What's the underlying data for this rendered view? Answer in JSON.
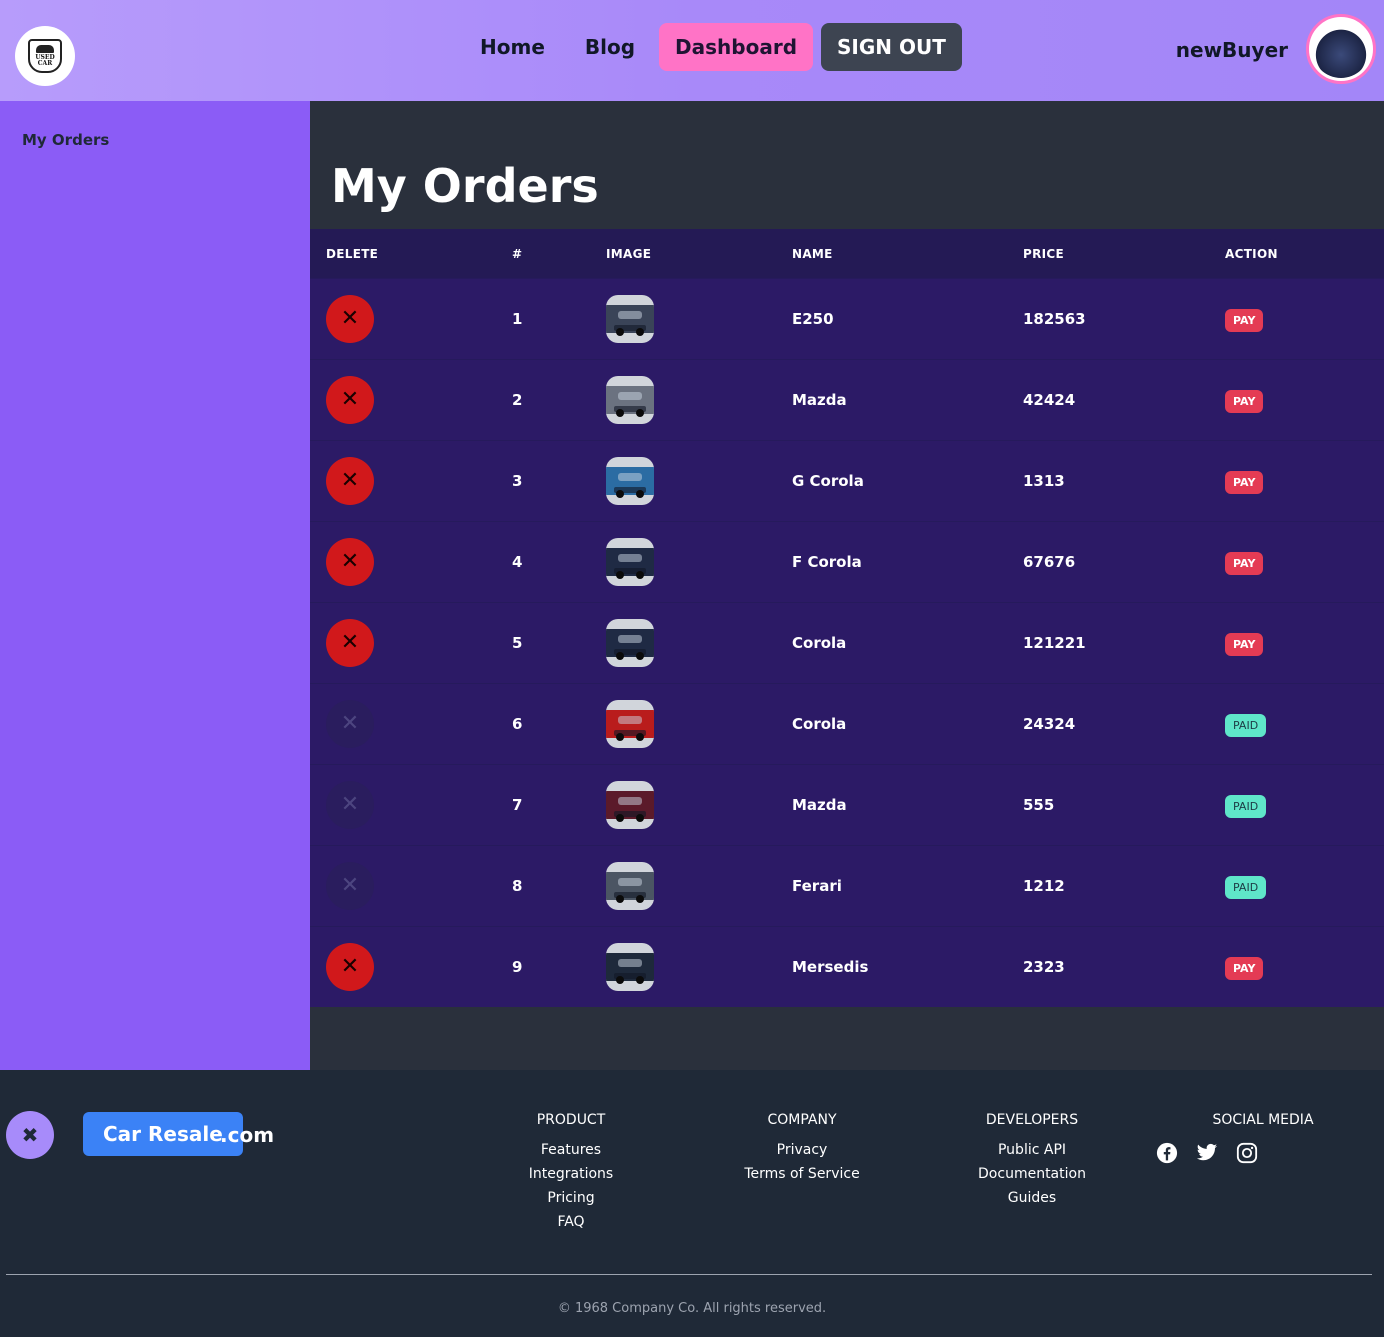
{
  "header": {
    "logo_text": "USED CAR",
    "nav": {
      "home": "Home",
      "blog": "Blog",
      "dashboard": "Dashboard",
      "signout": "SIGN OUT"
    },
    "username": "newBuyer"
  },
  "sidebar": {
    "items": [
      {
        "label": "My Orders"
      }
    ]
  },
  "main": {
    "title": "My Orders",
    "columns": [
      "DELETE",
      "#",
      "IMAGE",
      "NAME",
      "PRICE",
      "ACTION"
    ],
    "rows": [
      {
        "index": "1",
        "name": "E250",
        "price": "182563",
        "action": "PAY",
        "deletable": true,
        "thumb": "#3a4458"
      },
      {
        "index": "2",
        "name": "Mazda",
        "price": "42424",
        "action": "PAY",
        "deletable": true,
        "thumb": "#6b7280"
      },
      {
        "index": "3",
        "name": "G Corola",
        "price": "1313",
        "action": "PAY",
        "deletable": true,
        "thumb": "#2b6ca3"
      },
      {
        "index": "4",
        "name": "F Corola",
        "price": "67676",
        "action": "PAY",
        "deletable": true,
        "thumb": "#1f2a44"
      },
      {
        "index": "5",
        "name": "Corola",
        "price": "121221",
        "action": "PAY",
        "deletable": true,
        "thumb": "#1f2a44"
      },
      {
        "index": "6",
        "name": "Corola",
        "price": "24324",
        "action": "PAID",
        "deletable": false,
        "thumb": "#b91c1c"
      },
      {
        "index": "7",
        "name": "Mazda",
        "price": "555",
        "action": "PAID",
        "deletable": false,
        "thumb": "#5b1a2a"
      },
      {
        "index": "8",
        "name": "Ferari",
        "price": "1212",
        "action": "PAID",
        "deletable": false,
        "thumb": "#4b5563"
      },
      {
        "index": "9",
        "name": "Mersedis",
        "price": "2323",
        "action": "PAY",
        "deletable": true,
        "thumb": "#1e293b"
      }
    ]
  },
  "footer": {
    "brand": "Car Resale",
    "brand_suffix": ".com",
    "product": {
      "heading": "PRODUCT",
      "links": [
        "Features",
        "Integrations",
        "Pricing",
        "FAQ"
      ]
    },
    "company": {
      "heading": "COMPANY",
      "links": [
        "Privacy",
        "Terms of Service"
      ]
    },
    "developers": {
      "heading": "DEVELOPERS",
      "links": [
        "Public API",
        "Documentation",
        "Guides"
      ]
    },
    "social": {
      "heading": "SOCIAL MEDIA",
      "icons": [
        "facebook-icon",
        "twitter-icon",
        "instagram-icon"
      ]
    },
    "copyright": "© 1968 Company Co. All rights reserved."
  },
  "colors": {
    "pay": "#e43b54",
    "paid": "#5fe6c9",
    "delete": "#d1181b",
    "sidebar": "#8b5cf6",
    "dashboard_active": "#ff73c6"
  }
}
